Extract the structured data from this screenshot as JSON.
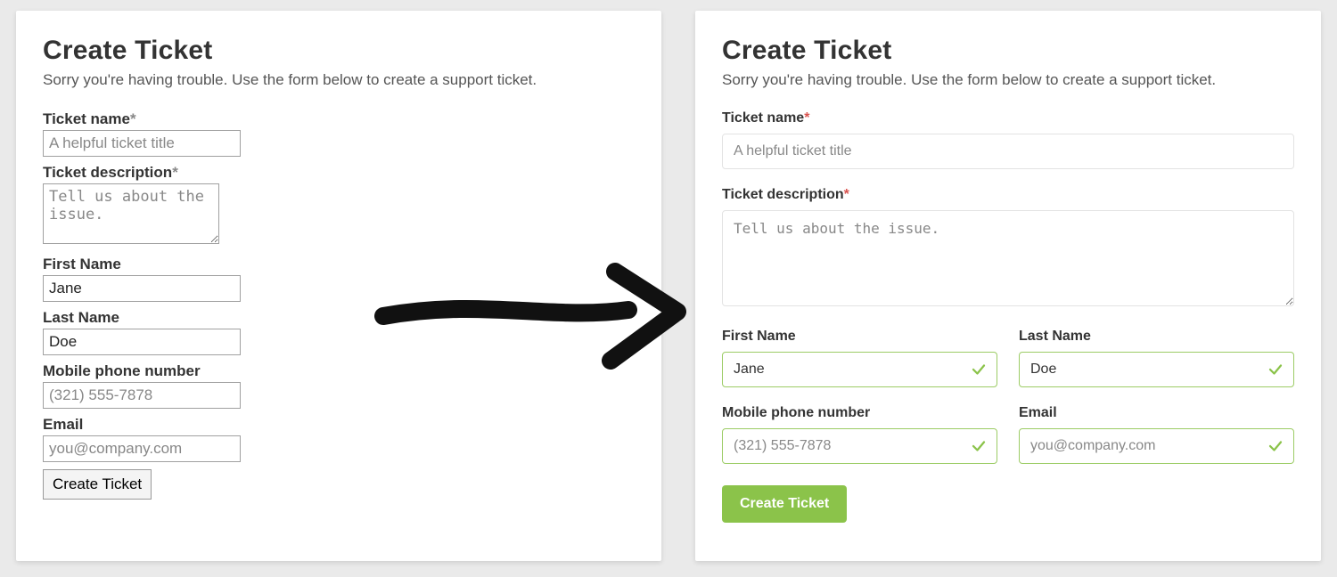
{
  "shared": {
    "title": "Create Ticket",
    "lead": "Sorry you're having trouble. Use the form below to create a support ticket.",
    "submit_label": "Create Ticket"
  },
  "fields": {
    "ticket_name": {
      "label": "Ticket name",
      "placeholder": "A helpful ticket title",
      "required": true
    },
    "ticket_description": {
      "label": "Ticket description",
      "placeholder": "Tell us about the issue.",
      "required": true
    },
    "first_name": {
      "label": "First Name",
      "value": "Jane"
    },
    "last_name": {
      "label": "Last Name",
      "value": "Doe"
    },
    "phone": {
      "label": "Mobile phone number",
      "placeholder": "(321) 555-7878"
    },
    "email": {
      "label": "Email",
      "placeholder": "you@company.com"
    }
  },
  "colors": {
    "accent_green": "#8bc34a",
    "required_red": "#d9534f"
  }
}
